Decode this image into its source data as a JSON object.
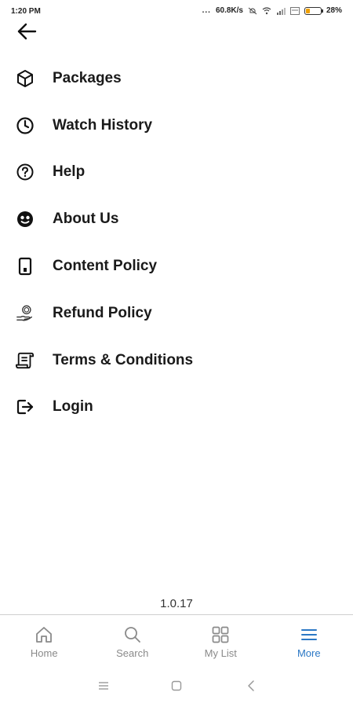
{
  "status_bar": {
    "time": "1:20 PM",
    "dots": "...",
    "network_speed": "60.8K/s",
    "battery_percent": "28%",
    "battery_level": 0.28,
    "icons": [
      "mute-icon",
      "wifi-icon",
      "signal-icon",
      "volte-icon",
      "battery-icon"
    ]
  },
  "header": {
    "back_icon": "arrow-left-icon"
  },
  "menu": {
    "items": [
      {
        "label": "Packages",
        "icon": "cube-icon"
      },
      {
        "label": "Watch History",
        "icon": "clock-icon"
      },
      {
        "label": "Help",
        "icon": "question-circle-icon"
      },
      {
        "label": "About Us",
        "icon": "smiley-icon"
      },
      {
        "label": "Content Policy",
        "icon": "phone-icon"
      },
      {
        "label": "Refund Policy",
        "icon": "refund-hand-icon"
      },
      {
        "label": "Terms & Conditions",
        "icon": "document-icon"
      },
      {
        "label": "Login",
        "icon": "login-icon"
      }
    ]
  },
  "app_version": "1.0.17",
  "bottom_nav": {
    "items": [
      {
        "label": "Home",
        "icon": "home-icon",
        "active": false
      },
      {
        "label": "Search",
        "icon": "search-icon",
        "active": false
      },
      {
        "label": "My List",
        "icon": "grid-icon",
        "active": false
      },
      {
        "label": "More",
        "icon": "menu-icon",
        "active": true
      }
    ],
    "active_color": "#2b78c5",
    "inactive_color": "#8a8a8a"
  },
  "system_nav": {
    "icons": [
      "recents-icon",
      "home-square-icon",
      "back-chevron-icon"
    ]
  }
}
